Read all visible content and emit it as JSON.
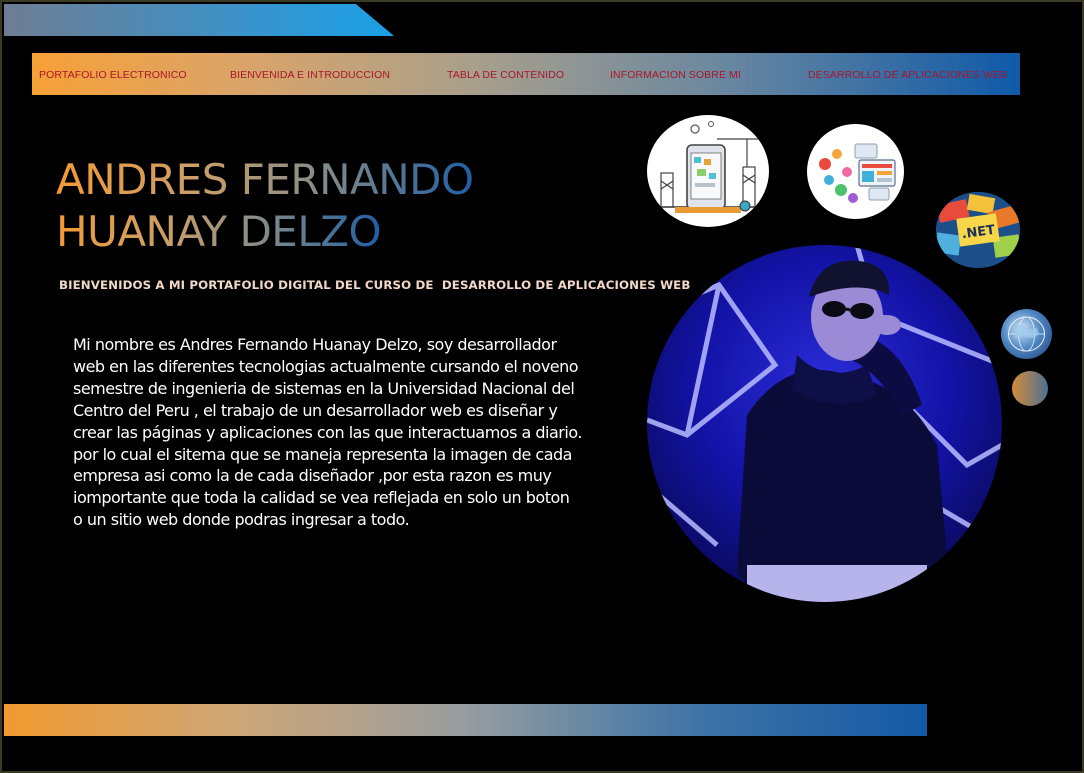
{
  "nav": {
    "items": [
      {
        "label": "PORTAFOLIO ELECTRONICO"
      },
      {
        "label": "BIENVENIDA E INTRODUCCION"
      },
      {
        "label": "TABLA DE CONTENIDO"
      },
      {
        "label": "INFORMACION SOBRE MI"
      },
      {
        "label": "DESARROLLO DE APLICACIONES WEB"
      }
    ]
  },
  "hero": {
    "name_line1": "ANDRES FERNANDO",
    "name_line2": "HUANAY DELZO",
    "subtitle": "BIENVENIDOS A MI PORTAFOLIO DIGITAL DEL CURSO DE  DESARROLLO DE APLICACIONES WEB",
    "bio": "Mi nombre es Andres Fernando Huanay Delzo, soy desarrollador\nweb en las diferentes tecnologias actualmente cursando el noveno\nsemestre de ingenieria de sistemas en la Universidad Nacional del\nCentro del Peru , el trabajo de  un desarrollador web es  diseñar y\ncrear las páginas y aplicaciones con las que interactuamos a diario.\npor lo cual el sitema que se maneja representa la imagen de cada\nempresa asi como la de cada diseñador ,por esta razon es muy\niomportante que toda la calidad se vea reflejada en solo un boton\no un sitio web donde podras ingresar a todo."
  },
  "images": {
    "net_logo_text": ".NET"
  },
  "colors": {
    "background": "#000000",
    "nav_text": "#a9162a",
    "gradient_orange": "#f39b35",
    "gradient_blue": "#1559a6",
    "photo_blue": "#1313a8"
  },
  "icons": [
    "mobile-app-development-icon",
    "web-apps-illustration-icon",
    "dotnet-logo-icon",
    "globe-icon"
  ]
}
